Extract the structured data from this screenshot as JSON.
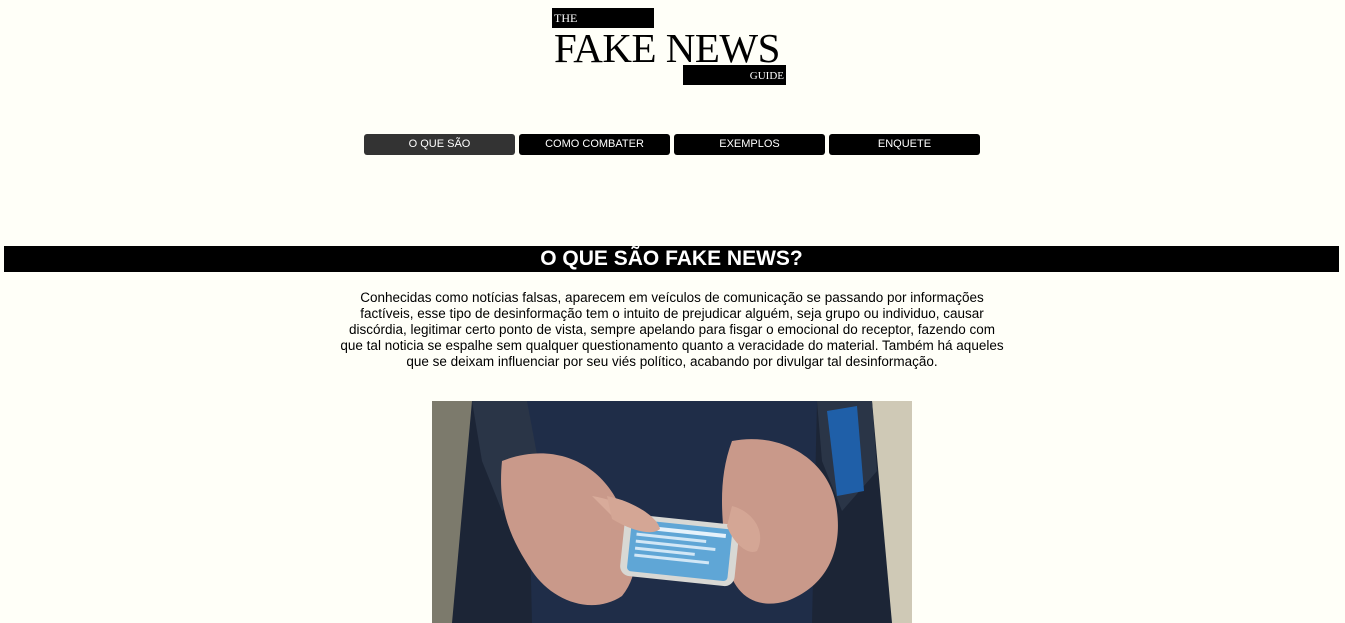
{
  "logo": {
    "the": "THE",
    "main": "FAKE NEWS",
    "guide": "GUIDE"
  },
  "nav": {
    "items": [
      {
        "label": "O QUE SÃO",
        "active": true
      },
      {
        "label": "COMO COMBATER",
        "active": false
      },
      {
        "label": "EXEMPLOS",
        "active": false
      },
      {
        "label": "ENQUETE",
        "active": false
      }
    ]
  },
  "section": {
    "title": "O QUE SÃO FAKE NEWS?",
    "body": "Conhecidas como notícias falsas, aparecem em veículos de comunicação se passando por informações factíveis, esse tipo de desinformação tem o intuito de prejudicar alguém, seja grupo ou individuo, causar discórdia, legitimar certo ponto de vista, sempre apelando para fisgar o emocional do receptor, fazendo com que tal noticia se espalhe sem qualquer questionamento quanto a veracidade do material. Também há aqueles que se deixam influenciar por seu viés político, acabando por divulgar tal desinformação."
  },
  "colors": {
    "background": "#fffff8",
    "nav_bg": "#000000",
    "nav_active_bg": "#333333",
    "banner_bg": "#000000",
    "text": "#000000"
  }
}
